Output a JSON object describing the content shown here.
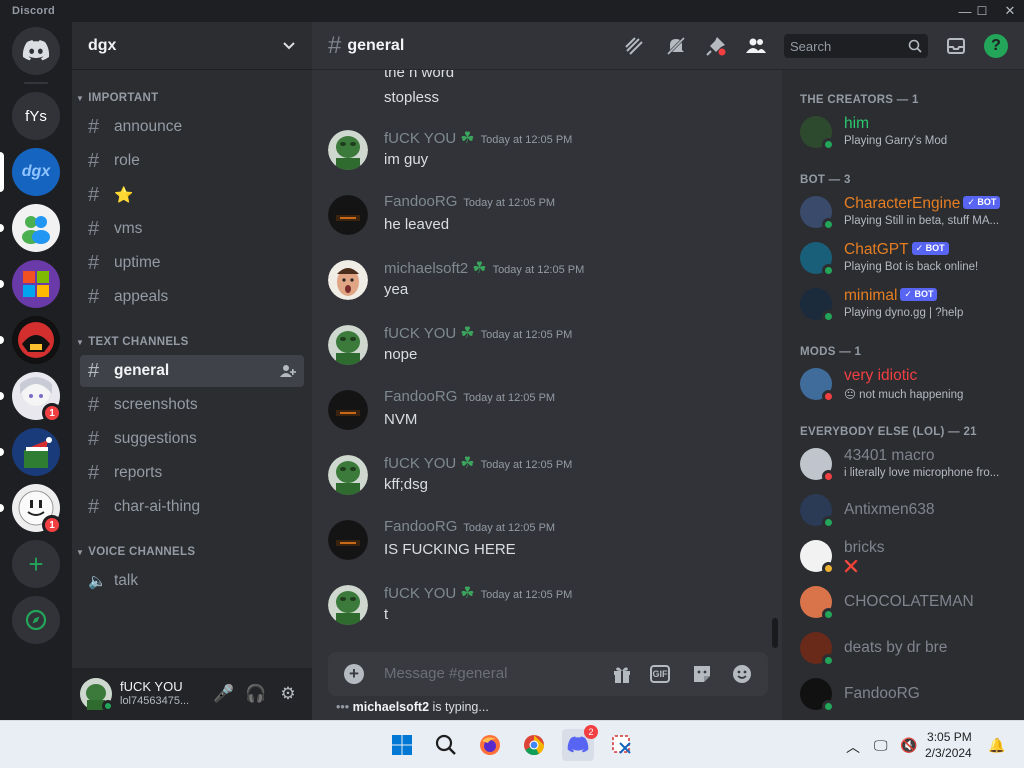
{
  "window": {
    "title": "Discord",
    "controls": [
      "—",
      "☐",
      "✕"
    ]
  },
  "servers": [
    {
      "name": "Home",
      "icon": "discord-logo-icon",
      "bg": "#313338"
    },
    {
      "name": "fYs",
      "label": "fYs",
      "bg": "#313338"
    },
    {
      "name": "dgx",
      "label": "dgx",
      "bg": "#1565c0",
      "selected": true
    },
    {
      "name": "messenger",
      "icon": "messenger-people-icon",
      "bg": "#f2f2f2"
    },
    {
      "name": "windows",
      "icon": "windows-logo-icon",
      "bg": "#6a3aa8"
    },
    {
      "name": "red-mask",
      "icon": "mask-icon",
      "bg": "#111111"
    },
    {
      "name": "anime",
      "icon": "anime-icon",
      "bg": "#e8e8ee",
      "badge": "1"
    },
    {
      "name": "christmas",
      "icon": "christmas-hat-icon",
      "bg": "#1a3b7a"
    },
    {
      "name": "smiley",
      "icon": "smiley-ball-icon",
      "bg": "#eeeeee",
      "badge": "1"
    }
  ],
  "guild": {
    "name": "dgx"
  },
  "categories": {
    "important": "IMPORTANT",
    "text": "TEXT CHANNELS",
    "voice": "VOICE CHANNELS"
  },
  "channels": {
    "important": [
      "announce",
      "role",
      "⭐",
      "vms",
      "uptime",
      "appeals"
    ],
    "text": [
      "general",
      "screenshots",
      "suggestions",
      "reports",
      "char-ai-thing"
    ],
    "voice": [
      "talk"
    ]
  },
  "user": {
    "name": "fUCK YOU",
    "tag": "lol74563475..."
  },
  "chat": {
    "channel": "general",
    "search_placeholder": "Search",
    "top_lines": [
      "the n word",
      "stopless"
    ],
    "messages": [
      {
        "author": "fUCK YOU",
        "leaf": true,
        "time": "Today at 12:05 PM",
        "text": "im guy",
        "avatar": "frog"
      },
      {
        "author": "FandooRG",
        "leaf": false,
        "time": "Today at 12:05 PM",
        "text": "he leaved",
        "avatar": "dark"
      },
      {
        "author": "michaelsoft2",
        "leaf": true,
        "time": "Today at 12:05 PM",
        "text": "yea",
        "avatar": "face"
      },
      {
        "author": "fUCK YOU",
        "leaf": true,
        "time": "Today at 12:05 PM",
        "text": "nope",
        "avatar": "frog"
      },
      {
        "author": "FandooRG",
        "leaf": false,
        "time": "Today at 12:05 PM",
        "text": "NVM",
        "avatar": "dark"
      },
      {
        "author": "fUCK YOU",
        "leaf": true,
        "time": "Today at 12:05 PM",
        "text": "kff;dsg",
        "avatar": "frog"
      },
      {
        "author": "FandooRG",
        "leaf": false,
        "time": "Today at 12:05 PM",
        "text": "IS FUCKING HERE",
        "avatar": "dark"
      },
      {
        "author": "fUCK YOU",
        "leaf": true,
        "time": "Today at 12:05 PM",
        "text": "t",
        "avatar": "frog"
      }
    ],
    "composer_placeholder": "Message #general",
    "gif_label": "GIF",
    "typing_user": "michaelsoft2",
    "typing_suffix": " is typing..."
  },
  "members": {
    "groups": [
      {
        "title": "THE CREATORS — 1",
        "members": [
          {
            "name": "him",
            "activity": "Playing Garry's Mod",
            "color": "#2dc770",
            "status": "online"
          }
        ]
      },
      {
        "title": "BOT — 3",
        "members": [
          {
            "name": "CharacterEngine",
            "activity": "Playing Still in beta, stuff MA...",
            "color": "#e67e22",
            "status": "online",
            "bot": true
          },
          {
            "name": "ChatGPT",
            "activity": "Playing Bot is back online!",
            "color": "#e67e22",
            "status": "online",
            "bot": true
          },
          {
            "name": "minimal",
            "activity": "Playing dyno.gg | ?help",
            "color": "#e67e22",
            "status": "online",
            "bot": true
          }
        ]
      },
      {
        "title": "MODS — 1",
        "members": [
          {
            "name": "very idiotic",
            "activity": "😐 not much happening",
            "color": "#f23f42",
            "status": "dnd"
          }
        ]
      },
      {
        "title": "EVERYBODY ELSE (LOL) — 21",
        "members": [
          {
            "name": "43401 macro",
            "activity": "i literally love microphone fro...",
            "color": "#80848e",
            "status": "dnd"
          },
          {
            "name": "Antixmen638",
            "activity": "",
            "color": "#80848e",
            "status": "online"
          },
          {
            "name": "bricks",
            "activity": "❌",
            "color": "#80848e",
            "status": "idle"
          },
          {
            "name": "CHOCOLATEMAN",
            "activity": "",
            "color": "#80848e",
            "status": "online"
          },
          {
            "name": "deats by dr bre",
            "activity": "",
            "color": "#80848e",
            "status": "online"
          },
          {
            "name": "FandooRG",
            "activity": "",
            "color": "#80848e",
            "status": "online"
          }
        ]
      }
    ]
  },
  "taskbar": {
    "clock_time": "3:05 PM",
    "clock_date": "2/3/2024",
    "discord_badge": "2"
  },
  "colors": {
    "online": "#23a55a",
    "idle": "#f0b232",
    "dnd": "#f23f42",
    "accent": "#5865f2"
  }
}
